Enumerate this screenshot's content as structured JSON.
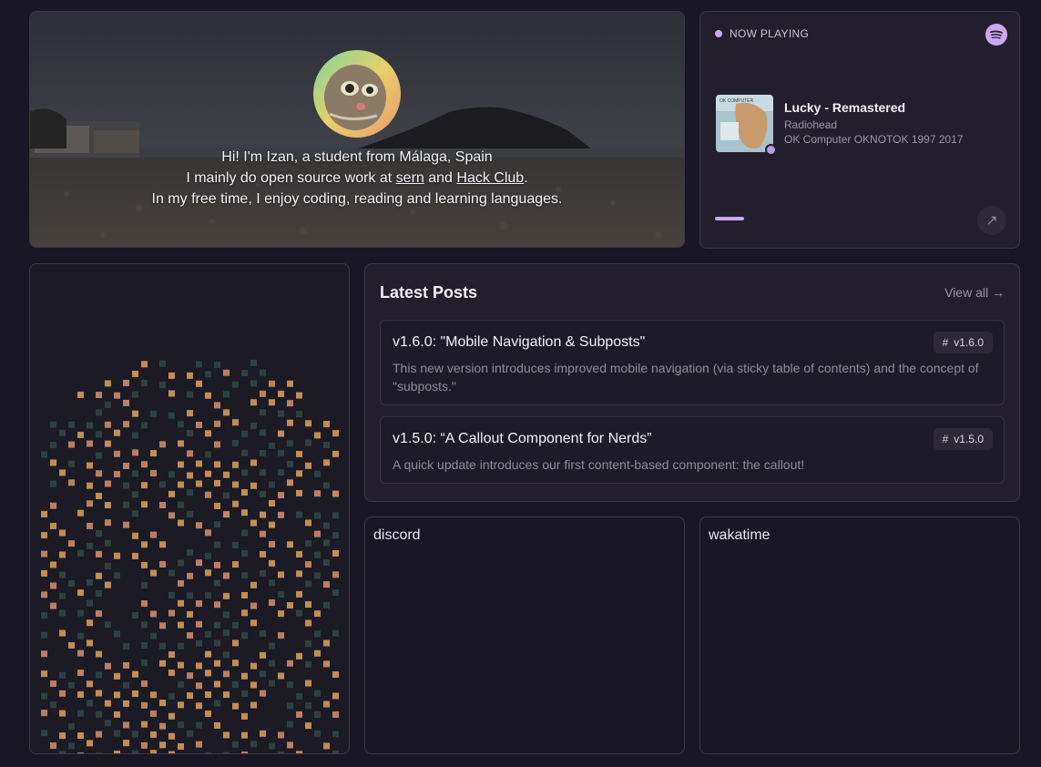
{
  "hero": {
    "line1": "Hi! I'm Izan, a student from Málaga, Spain",
    "line2_prefix": "I mainly do open source work at ",
    "link_sern": "sern",
    "line2_mid": " and ",
    "link_hackclub": "Hack Club",
    "line2_suffix": ".",
    "line3": "In my free time, I enjoy coding, reading and learning languages."
  },
  "now_playing": {
    "label": "NOW PLAYING",
    "track": "Lucky - Remastered",
    "artist": "Radiohead",
    "album": "OK Computer OKNOTOK 1997 2017",
    "progress": 0.1,
    "cover_text": "OK COMPUTER",
    "open_icon": "↗",
    "accent": "#c9a9f0",
    "spotify_color": "#c9a9f0"
  },
  "posts": {
    "title": "Latest Posts",
    "view_all": "View all →",
    "items": [
      {
        "title": "v1.6.0: \"Mobile Navigation & Subposts\"",
        "description": "This new version introduces improved mobile navigation (via sticky table of contents) and the concept of \"subposts.\"",
        "tag": "v1.6.0"
      },
      {
        "title": "v1.5.0: “A Callout Component for Nerds”",
        "description": "A quick update introduces our first content-based component: the callout!",
        "tag": "v1.5.0"
      }
    ],
    "tag_icon": "#"
  },
  "widgets": {
    "discord": "discord",
    "wakatime": "wakatime"
  },
  "pattern": {
    "colors": [
      "#e0a35c",
      "#2f4a44",
      "#d9926e"
    ]
  }
}
